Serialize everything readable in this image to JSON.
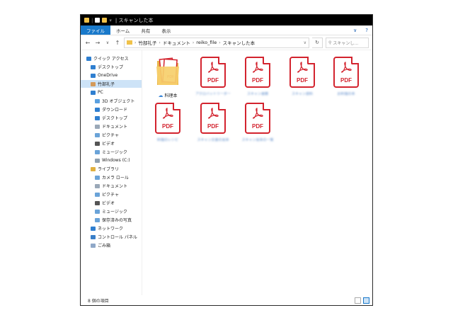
{
  "window": {
    "title": "| スキャンした本"
  },
  "ribbon": {
    "tabs": [
      "ファイル",
      "ホーム",
      "共有",
      "表示"
    ]
  },
  "nav": {
    "back": "←",
    "forward": "→",
    "up": "↑",
    "recent": "∨",
    "breadcrumb": [
      "竹部礼子",
      "ドキュメント",
      "reiko_file",
      "スキャンした本"
    ],
    "search_placeholder": "スキャンし..."
  },
  "sidebar": {
    "items": [
      {
        "label": "クイック アクセス",
        "icon": "star-icon"
      },
      {
        "label": "デスクトップ",
        "icon": "desktop-icon"
      },
      {
        "label": "OneDrive",
        "icon": "cloud-icon"
      },
      {
        "label": "竹部礼子",
        "icon": "user-icon",
        "selected": true
      },
      {
        "label": "PC",
        "icon": "pc-icon"
      },
      {
        "label": "3D オブジェクト",
        "icon": "cube-icon"
      },
      {
        "label": "ダウンロード",
        "icon": "download-icon"
      },
      {
        "label": "デスクトップ",
        "icon": "desktop-icon"
      },
      {
        "label": "ドキュメント",
        "icon": "document-icon"
      },
      {
        "label": "ピクチャ",
        "icon": "picture-icon"
      },
      {
        "label": "ビデオ",
        "icon": "video-icon"
      },
      {
        "label": "ミュージック",
        "icon": "music-icon"
      },
      {
        "label": "Windows (C:)",
        "icon": "drive-icon"
      },
      {
        "label": "ライブラリ",
        "icon": "library-icon"
      },
      {
        "label": "カメラ ロール",
        "icon": "camera-icon"
      },
      {
        "label": "ドキュメント",
        "icon": "document-icon"
      },
      {
        "label": "ピクチャ",
        "icon": "picture-icon"
      },
      {
        "label": "ビデオ",
        "icon": "video-icon"
      },
      {
        "label": "ミュージック",
        "icon": "music-icon"
      },
      {
        "label": "保存済みの写真",
        "icon": "picture-icon"
      },
      {
        "label": "ネットワーク",
        "icon": "network-icon"
      },
      {
        "label": "コントロール パネル",
        "icon": "control-panel-icon"
      },
      {
        "label": "ごみ箱",
        "icon": "recycle-bin-icon"
      }
    ]
  },
  "content": {
    "folder": {
      "label": "料理本"
    },
    "pdf_label": "PDF",
    "files": [
      {
        "name": "アクロバットリーダー"
      },
      {
        "name": "スキャン書籍"
      },
      {
        "name": "スキャン資料"
      },
      {
        "name": "お料理の本"
      },
      {
        "name": "料理のレシピ"
      },
      {
        "name": "スキャン文書の見本"
      },
      {
        "name": "スキャン見本の一覧"
      }
    ]
  },
  "status": {
    "count": "8 個の項目"
  },
  "colors": {
    "pdf_red": "#d3232e",
    "accent_blue": "#1979ca",
    "folder_yellow": "#f0c24a"
  }
}
